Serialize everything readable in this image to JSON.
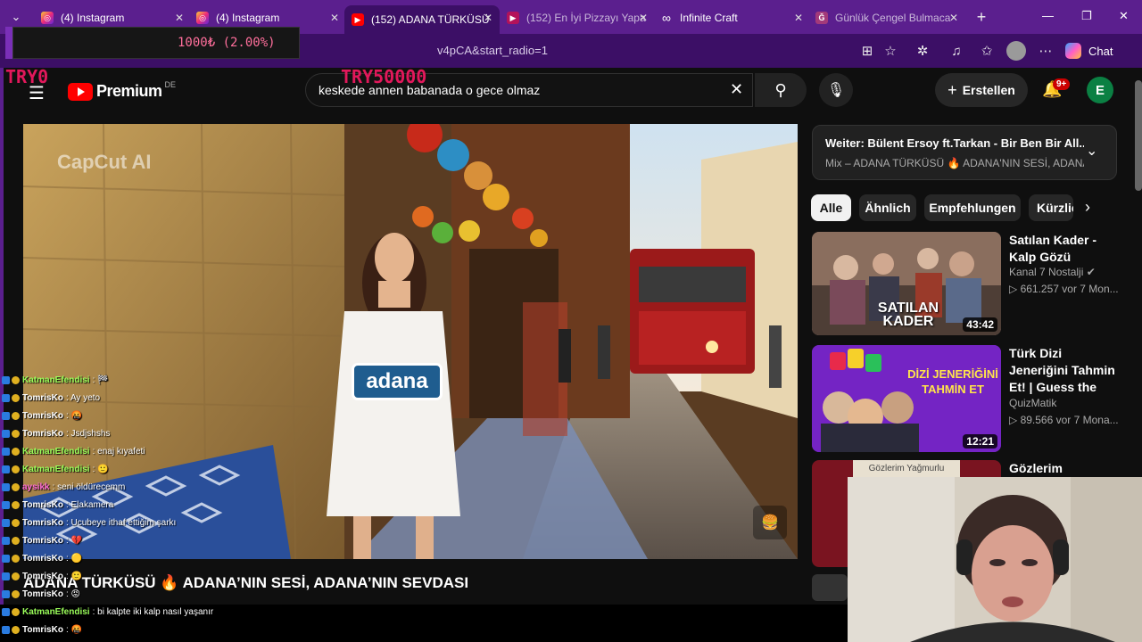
{
  "browser": {
    "tabs": [
      {
        "title": "(4) Instagram",
        "icon": "instagram-icon",
        "active": false,
        "muted": false
      },
      {
        "title": "(4) Instagram",
        "icon": "instagram-icon",
        "active": false,
        "muted": false
      },
      {
        "title": "(152) ADANA TÜRKÜSÜ",
        "icon": "youtube-icon",
        "active": true,
        "muted": false
      },
      {
        "title": "(152) En İyi Pizzayı Yapa",
        "icon": "youtube-icon",
        "active": false,
        "muted": true
      },
      {
        "title": "Infinite Craft",
        "icon": "infinity-icon",
        "active": false,
        "muted": false
      },
      {
        "title": "Günlük Çengel Bulmaca",
        "icon": "puzzle-icon",
        "active": false,
        "muted": true
      }
    ],
    "new_tab": "+",
    "url_fragment": "v4pCA&start_radio=1",
    "chat_label": "Chat"
  },
  "overlay": {
    "donation_text": "1000₺ (2.00%)",
    "try_left": "TRY0",
    "try_right": "TRY50000"
  },
  "youtube": {
    "logo": "Premium",
    "region": "DE",
    "search_query": "keskede annen babanada o gece olmaz",
    "create_label": "Erstellen",
    "notif_count": "9+",
    "avatar_letter": "E",
    "video": {
      "watermark": "CapCut AI",
      "sign_text": "adana",
      "title": "ADANA TÜRKÜSÜ 🔥 ADANA’NIN SESİ, ADANA’NIN SEVDASI"
    },
    "up_next": {
      "line1": "Weiter: Bülent Ersoy ft.Tarkan - Bir Ben Bir All...",
      "line2": "Mix – ADANA TÜRKÜSÜ 🔥 ADANA'NIN SESİ, ADANA..."
    },
    "chips": [
      "Alle",
      "Ähnlich",
      "Empfehlungen",
      "Kürzlich"
    ],
    "related": [
      {
        "title": "Satılan Kader - Kalp Gözü",
        "channel": "Kanal 7 Nostalji ✔",
        "meta": "▷ 661.257 vor 7 Mon...",
        "duration": "43:42",
        "thumb_text": "SATILAN KADER"
      },
      {
        "title": "Türk Dizi Jeneriğini Tahmin Et! | Guess the Turkish Series ...",
        "channel": "QuizMatik",
        "meta": "▷ 89.566 vor 7 Mona...",
        "duration": "12:21",
        "thumb_text": "DİZİ JENERİĞİNİ TAHMİN ET"
      },
      {
        "title": "Gözlerim Yağmurlu |",
        "channel": "",
        "meta": "",
        "duration": "",
        "thumb_text": "Gözlerim Yağmurlu"
      }
    ]
  },
  "chat": [
    {
      "user": "KatmanEfendisi",
      "msg": ": 🏁",
      "color": "#9bff5a"
    },
    {
      "user": "TomrisKo",
      "msg": ": Ay yeto",
      "color": "#ffffff"
    },
    {
      "user": "TomrisKo",
      "msg": ": 🤬",
      "color": "#ffffff"
    },
    {
      "user": "TomrisKo",
      "msg": ": Jsdjshshs",
      "color": "#ffffff"
    },
    {
      "user": "KatmanEfendisi",
      "msg": ": enaj kıyafeti",
      "color": "#9bff5a"
    },
    {
      "user": "KatmanEfendisi",
      "msg": ": 🙂",
      "color": "#9bff5a"
    },
    {
      "user": "aysikk",
      "msg": ": seni öldürecemm",
      "color": "#ff6bd6"
    },
    {
      "user": "TomrisKo",
      "msg": ": Elakamera",
      "color": "#ffffff"
    },
    {
      "user": "TomrisKo",
      "msg": ": Ucubeye ithaf ettiğim şarkı",
      "color": "#ffffff"
    },
    {
      "user": "TomrisKo",
      "msg": ": 💔",
      "color": "#ffffff"
    },
    {
      "user": "TomrisKo",
      "msg": ": 🟡",
      "color": "#ffffff"
    },
    {
      "user": "TomrisKo",
      "msg": ": 🙂",
      "color": "#ffffff"
    },
    {
      "user": "TomrisKo",
      "msg": ": 😡",
      "color": "#ffffff"
    },
    {
      "user": "KatmanEfendisi",
      "msg": ": bi kalpte iki kalp nasıl yaşanır",
      "color": "#9bff5a"
    },
    {
      "user": "TomrisKo",
      "msg": ": 🤬",
      "color": "#ffffff"
    }
  ]
}
